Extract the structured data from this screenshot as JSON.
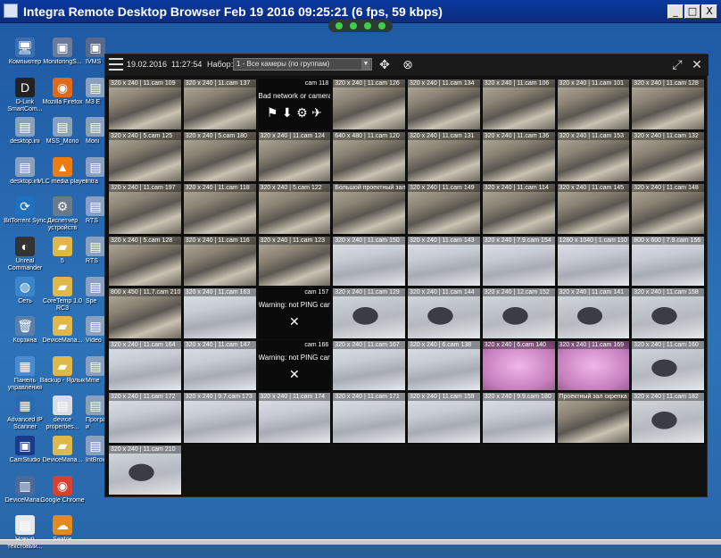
{
  "window": {
    "title": "Integra Remote Desktop Browser Feb 19 2016 09:25:21 (6 fps, 59 kbps)",
    "minimize": "_",
    "maximize": "□",
    "close": "X"
  },
  "desktop_icons": [
    {
      "label": "Компьютер",
      "glyph": "🖥",
      "color": "#3b6fb0"
    },
    {
      "label": "MonitoringS...",
      "glyph": "▣",
      "color": "#6b7c99"
    },
    {
      "label": "D-Link SmartCom...",
      "glyph": "D",
      "color": "#222"
    },
    {
      "label": "Mozilla Firefox",
      "glyph": "◉",
      "color": "#e06a1a"
    },
    {
      "label": "desktop.ini",
      "glyph": "▤",
      "color": "#8aa0c0"
    },
    {
      "label": "MSS_Mono",
      "glyph": "▤",
      "color": "#8aa0c0"
    },
    {
      "label": "desktop.ini",
      "glyph": "▤",
      "color": "#8aa0c0"
    },
    {
      "label": "VLC media player",
      "glyph": "▲",
      "color": "#ee7a10"
    },
    {
      "label": "BitTorrent Sync",
      "glyph": "⟳",
      "color": "#2070c0"
    },
    {
      "label": "Диспетчер устройств",
      "glyph": "⚙",
      "color": "#6a7a8a"
    },
    {
      "label": "Unreal Commander",
      "glyph": "◐",
      "color": "#333"
    },
    {
      "label": "5",
      "glyph": "▰",
      "color": "#e0b84a"
    },
    {
      "label": "Сеть",
      "glyph": "◍",
      "color": "#3a86c8"
    },
    {
      "label": "CoreTemp 1.0 RC3",
      "glyph": "▰",
      "color": "#e0b84a"
    },
    {
      "label": "Корзина",
      "glyph": "🗑",
      "color": "#5a7fa8"
    },
    {
      "label": "DeviceMana...",
      "glyph": "▰",
      "color": "#e0b84a"
    },
    {
      "label": "Панель управления",
      "glyph": "▦",
      "color": "#4a8ad0"
    },
    {
      "label": "Backup - Ярлык",
      "glyph": "▰",
      "color": "#e0b84a"
    },
    {
      "label": "Advanced IP Scanner",
      "glyph": "▦",
      "color": "#2a6bb0"
    },
    {
      "label": "device properties...",
      "glyph": "▤",
      "color": "#d8dde6"
    },
    {
      "label": "CamStudio",
      "glyph": "▣",
      "color": "#1a3a8a"
    },
    {
      "label": "DeviceMana...",
      "glyph": "▰",
      "color": "#e0b84a"
    },
    {
      "label": "DeviceMana...",
      "glyph": "▥",
      "color": "#4a6a9a"
    },
    {
      "label": "Google Chrome",
      "glyph": "◉",
      "color": "#d84030"
    },
    {
      "label": "Новый текстовый...",
      "glyph": "▤",
      "color": "#e6e9ee"
    },
    {
      "label": "Seafile",
      "glyph": "☁",
      "color": "#e28a1a"
    }
  ],
  "side_icons": [
    {
      "label": "IVMS",
      "glyph": "▣",
      "color": "#5a6a8a"
    },
    {
      "label": "M3 E",
      "glyph": "▤",
      "color": "#8aa0c0"
    },
    {
      "label": "Moni",
      "glyph": "▤",
      "color": "#8aa0c0"
    },
    {
      "label": "Intra",
      "glyph": "▤",
      "color": "#8aa0c0"
    },
    {
      "label": "RTS",
      "glyph": "▤",
      "color": "#8aa0c0"
    },
    {
      "label": "RTS",
      "glyph": "▤",
      "color": "#8aa0c0"
    },
    {
      "label": "Spe",
      "glyph": "▤",
      "color": "#8aa0c0"
    },
    {
      "label": "Video",
      "glyph": "▤",
      "color": "#8aa0c0"
    },
    {
      "label": "Mme",
      "glyph": "▤",
      "color": "#8aa0c0"
    },
    {
      "label": "Программы и компонент...",
      "glyph": "▤",
      "color": "#8aa0c0"
    },
    {
      "label": "IntBrowser",
      "glyph": "▤",
      "color": "#8aa0c0"
    }
  ],
  "toolbar": {
    "date": "19.02.2016",
    "time": "11:27:54",
    "set_label": "Набор:",
    "set_value": "1 - Все камеры (по группам)",
    "menu_icon": "menu-icon",
    "move_icon": "move-icon",
    "zoom_icon": "zoom-out-icon",
    "fullscreen_icon": "fullscreen-icon",
    "close_icon": "close-icon"
  },
  "cameras": [
    {
      "label": "320 x 240 | 11.cam 109",
      "style": "office"
    },
    {
      "label": "320 x 240 | 11.cam 137",
      "style": "office"
    },
    {
      "label": "cam 118",
      "style": "dark",
      "msg": "Bad network or camera",
      "sym": "⚑ ⬇ ⚙ ✈"
    },
    {
      "label": "320 x 240 | 11.cam 126",
      "style": "office"
    },
    {
      "label": "320 x 240 | 11.cam 134",
      "style": "office"
    },
    {
      "label": "320 x 240 | 11.cam 106",
      "style": "office"
    },
    {
      "label": "320 x 240 | 11.cam 101",
      "style": "office"
    },
    {
      "label": "320 x 240 | 11.cam 128",
      "style": "office"
    },
    {
      "label": "320 x 240 | 5.cam 125",
      "style": "office"
    },
    {
      "label": "320 x 240 | 5.cam 180",
      "style": "office"
    },
    {
      "label": "320 x 240 | 11.cam 124",
      "style": "office"
    },
    {
      "label": "640 x 480 | 11.cam 120",
      "style": "office"
    },
    {
      "label": "320 x 240 | 11.cam 131",
      "style": "office"
    },
    {
      "label": "320 x 240 | 11.cam 136",
      "style": "office"
    },
    {
      "label": "320 x 240 | 11.cam 153",
      "style": "office"
    },
    {
      "label": "320 x 240 | 11.cam 132",
      "style": "office"
    },
    {
      "label": "320 x 240 | 11.cam 197",
      "style": "office"
    },
    {
      "label": "320 x 240 | 11.cam 118",
      "style": "office"
    },
    {
      "label": "320 x 240 | 5.cam 122",
      "style": "office"
    },
    {
      "label": "Большой проектный зал",
      "style": "office"
    },
    {
      "label": "320 x 240 | 11.cam 149",
      "style": "office"
    },
    {
      "label": "320 x 240 | 11.cam 114",
      "style": "office"
    },
    {
      "label": "320 x 240 | 11.cam 145",
      "style": "office"
    },
    {
      "label": "320 x 240 | 11.cam 148",
      "style": "office"
    },
    {
      "label": "320 x 240 | 5.cam 128",
      "style": "office"
    },
    {
      "label": "320 x 240 | 11.cam 116",
      "style": "office"
    },
    {
      "label": "320 x 240 | 11.cam 123",
      "style": "office"
    },
    {
      "label": "320 x 240 | 11.cam 150",
      "style": "snow"
    },
    {
      "label": "320 x 240 | 11.cam 143",
      "style": "snow"
    },
    {
      "label": "320 x 240 | 7.9.cam 154",
      "style": "snow"
    },
    {
      "label": "1280 x 1040 | 1.cam 110",
      "style": "snow"
    },
    {
      "label": "800 x 600 | 7.9.cam 156",
      "style": "snow"
    },
    {
      "label": "800 x 450 | 11.7.cam 210",
      "style": "office"
    },
    {
      "label": "320 x 240 | 11.cam 163",
      "style": "snow"
    },
    {
      "label": "cam 157",
      "style": "dark",
      "msg": "Warning: not PING camera",
      "sym": "✕"
    },
    {
      "label": "320 x 240 | 11.cam 129",
      "style": "snowcar"
    },
    {
      "label": "320 x 240 | 11.cam 144",
      "style": "snowcar"
    },
    {
      "label": "320 x 240 | 12.cam 152",
      "style": "snowcar"
    },
    {
      "label": "320 x 240 | 11.cam 141",
      "style": "snowcar"
    },
    {
      "label": "320 x 240 | 11.cam 158",
      "style": "snowcar"
    },
    {
      "label": "320 x 240 | 11.cam 164",
      "style": "snow"
    },
    {
      "label": "320 x 240 | 11.cam 147",
      "style": "snow"
    },
    {
      "label": "cam 166",
      "style": "dark",
      "msg": "Warning: not PING camera",
      "sym": "✕"
    },
    {
      "label": "320 x 240 | 11.cam 167",
      "style": "snow"
    },
    {
      "label": "320 x 240 | 6.cam 138",
      "style": "snow"
    },
    {
      "label": "320 x 240 | 6.cam 140",
      "style": "pink"
    },
    {
      "label": "320 x 240 | 11.cam 169",
      "style": "pink"
    },
    {
      "label": "320 x 240 | 11.cam 160",
      "style": "snowcar"
    },
    {
      "label": "320 x 240 | 11.cam 172",
      "style": "snow"
    },
    {
      "label": "320 x 240 | 9.7.cam 173",
      "style": "snow"
    },
    {
      "label": "320 x 240 | 11.cam 174",
      "style": "snow"
    },
    {
      "label": "320 x 240 | 11.cam 171",
      "style": "snow"
    },
    {
      "label": "320 x 240 | 11.cam 159",
      "style": "snow"
    },
    {
      "label": "320 x 240 | 9.9.cam 180",
      "style": "snow"
    },
    {
      "label": "Проектный зал скрепка",
      "style": "office"
    },
    {
      "label": "320 x 240 | 11.cam 182",
      "style": "snowcar"
    },
    {
      "label": "320 x 240 | 11.cam 210",
      "style": "snowcar"
    }
  ]
}
